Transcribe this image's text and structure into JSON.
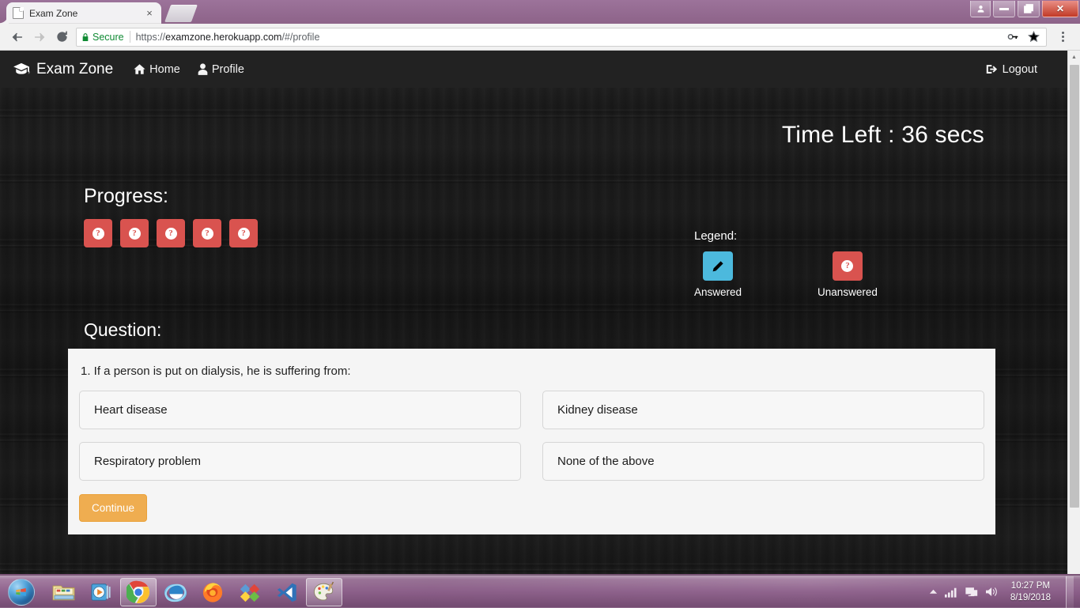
{
  "browser": {
    "tab": {
      "title": "Exam Zone",
      "favicon": "page-icon",
      "close": "×"
    },
    "newtab_label": "new-tab",
    "window_controls": {
      "user": "●",
      "minimize": "—",
      "restore": "❐",
      "close": "✕"
    },
    "toolbar": {
      "back": "←",
      "forward": "→",
      "reload": "⟳",
      "secure_label": "Secure",
      "url_scheme": "https://",
      "url_host": "examzone.herokuapp.com",
      "url_path": "/#/profile",
      "key_icon": "⚷",
      "bookmark_icon": "☆",
      "menu_icon": "kebab-menu"
    },
    "scrollbar": {
      "up_arrow": "▲"
    }
  },
  "app": {
    "navbar": {
      "brand": "Exam Zone",
      "links": [
        {
          "label": "Home",
          "icon": "home-icon"
        },
        {
          "label": "Profile",
          "icon": "user-icon"
        }
      ],
      "logout": {
        "label": "Logout",
        "icon": "sign-out-icon"
      }
    },
    "timer": "Time Left : 36 secs",
    "progress": {
      "title": "Progress:",
      "badges": [
        {
          "state": "unanswered",
          "icon": "question-circle-icon"
        },
        {
          "state": "unanswered",
          "icon": "question-circle-icon"
        },
        {
          "state": "unanswered",
          "icon": "question-circle-icon"
        },
        {
          "state": "unanswered",
          "icon": "question-circle-icon"
        },
        {
          "state": "unanswered",
          "icon": "question-circle-icon"
        }
      ]
    },
    "legend": {
      "title": "Legend:",
      "items": [
        {
          "label": "Answered",
          "state": "answered",
          "icon": "pencil-icon",
          "color": "#4cb9dd"
        },
        {
          "label": "Unanswered",
          "state": "unanswered",
          "icon": "question-circle-icon",
          "color": "#d9534f"
        }
      ]
    },
    "question_section": {
      "heading": "Question:",
      "number_text": "1. If a person is put on dialysis, he is suffering from:",
      "options": [
        "Heart disease",
        "Kidney disease",
        "Respiratory problem",
        "None of the above"
      ],
      "continue_label": "Continue"
    }
  },
  "taskbar": {
    "start": "start-orb",
    "items": [
      {
        "name": "file-explorer",
        "active": false
      },
      {
        "name": "windows-media-player",
        "active": false
      },
      {
        "name": "google-chrome",
        "active": true
      },
      {
        "name": "internet-explorer",
        "active": false
      },
      {
        "name": "mozilla-firefox",
        "active": false
      },
      {
        "name": "visual-studio-installer",
        "active": false
      },
      {
        "name": "visual-studio-code",
        "active": false
      },
      {
        "name": "ms-paint",
        "active": false
      }
    ],
    "tray": {
      "show_hidden": "▲",
      "network_signal": "signal-icon",
      "network": "network-icon",
      "volume": "volume-icon",
      "time": "10:27 PM",
      "date": "8/19/2018"
    }
  }
}
